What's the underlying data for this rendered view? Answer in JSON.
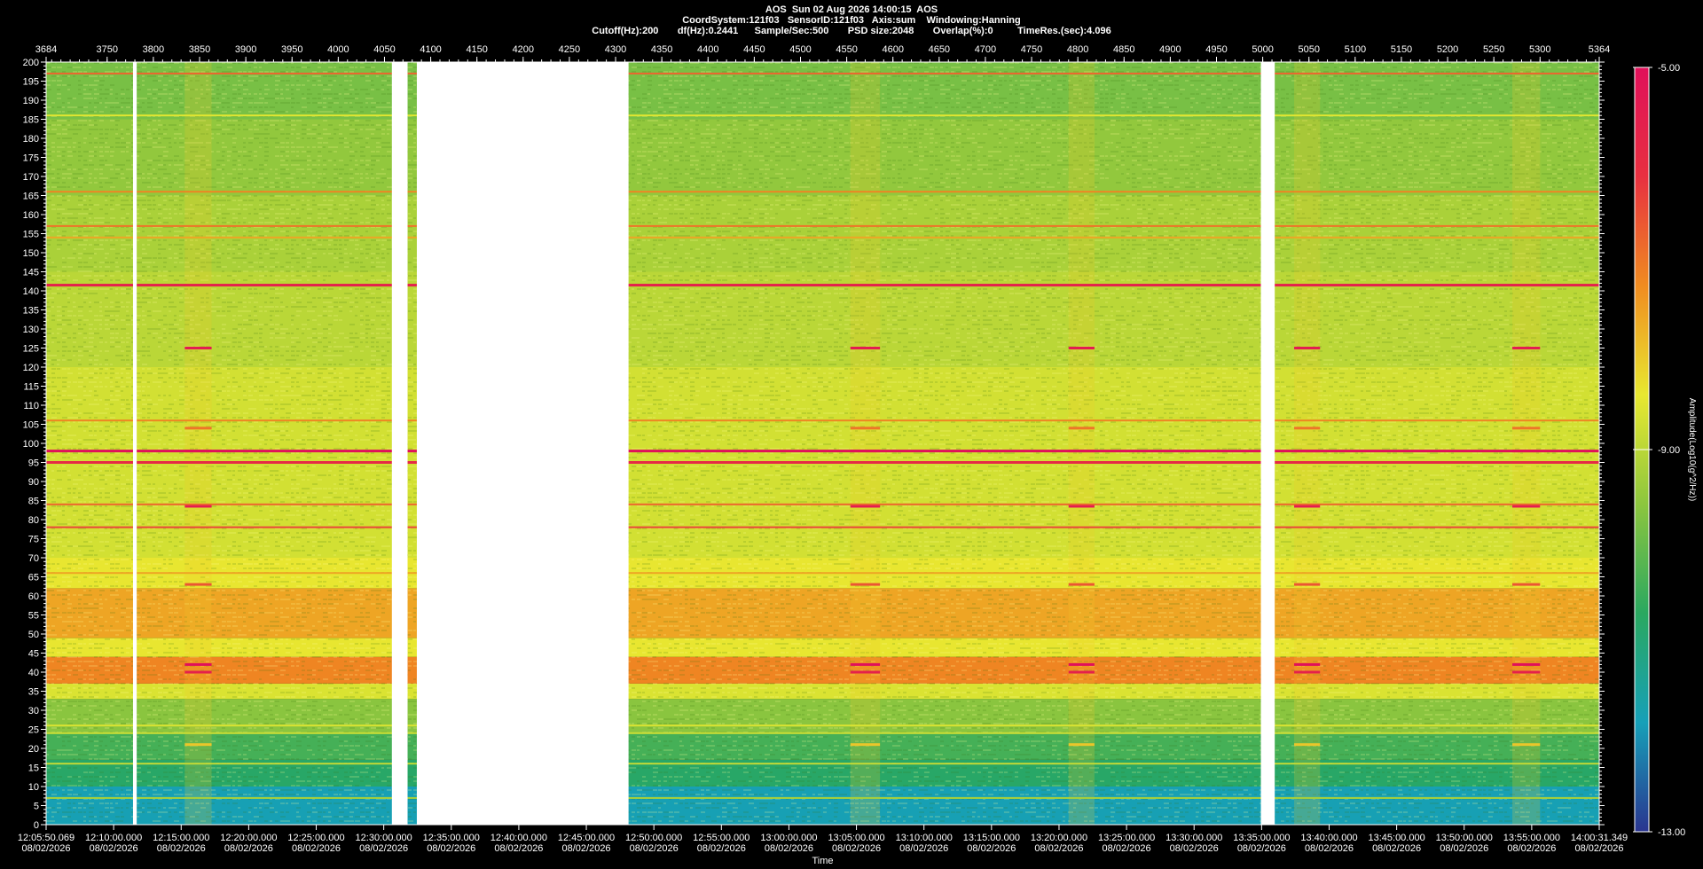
{
  "header": {
    "line1": "AOS  Sun 02 Aug 2026 14:00:15  AOS",
    "line2": "CoordSystem:121f03   SensorID:121f03   Axis:sum    Windowing:Hanning",
    "line3": "Cutoff(Hz):200       df(Hz):0.2441      Sample/Sec:500       PSD size:2048       Overlap(%):0         TimeRes.(sec):4.096"
  },
  "chart_data": {
    "type": "heatmap",
    "title": "AOS  Sun 02 Aug 2026 14:00:15  AOS",
    "xlabel": "Time",
    "ylabel": "",
    "colorbar_label": "Amplitude(Log10(g^2/Hz))",
    "colorbar_ticks": [
      "-5.00",
      "-9.00",
      "-13.00"
    ],
    "colorbar_range": [
      -13,
      -5
    ],
    "colormap": [
      "#2a3590",
      "#16a0b8",
      "#2aa860",
      "#8cc63e",
      "#e8e830",
      "#f08c20",
      "#e83040",
      "#e0105a"
    ],
    "ylim": [
      0,
      200
    ],
    "y_ticks": [
      0,
      5,
      10,
      15,
      20,
      25,
      30,
      35,
      40,
      45,
      50,
      55,
      60,
      65,
      70,
      75,
      80,
      85,
      90,
      95,
      100,
      105,
      110,
      115,
      120,
      125,
      130,
      135,
      140,
      145,
      150,
      155,
      160,
      165,
      170,
      175,
      180,
      185,
      190,
      195,
      200
    ],
    "top_axis_range": [
      3684,
      5364
    ],
    "top_axis_ticks": [
      "3684",
      "3750",
      "3800",
      "3850",
      "3900",
      "3950",
      "4000",
      "4050",
      "4100",
      "4150",
      "4200",
      "4250",
      "4300",
      "4350",
      "4400",
      "4450",
      "4500",
      "4550",
      "4600",
      "4650",
      "4700",
      "4750",
      "4800",
      "4850",
      "4900",
      "4950",
      "5000",
      "5050",
      "5100",
      "5150",
      "5200",
      "5250",
      "5300",
      "5364"
    ],
    "time_ticks": [
      {
        "time": "12:05:50.069",
        "date": "08/02/2026"
      },
      {
        "time": "12:10:00.000",
        "date": "08/02/2026"
      },
      {
        "time": "12:15:00.000",
        "date": "08/02/2026"
      },
      {
        "time": "12:20:00.000",
        "date": "08/02/2026"
      },
      {
        "time": "12:25:00.000",
        "date": "08/02/2026"
      },
      {
        "time": "12:30:00.000",
        "date": "08/02/2026"
      },
      {
        "time": "12:35:00.000",
        "date": "08/02/2026"
      },
      {
        "time": "12:40:00.000",
        "date": "08/02/2026"
      },
      {
        "time": "12:45:00.000",
        "date": "08/02/2026"
      },
      {
        "time": "12:50:00.000",
        "date": "08/02/2026"
      },
      {
        "time": "12:55:00.000",
        "date": "08/02/2026"
      },
      {
        "time": "13:00:00.000",
        "date": "08/02/2026"
      },
      {
        "time": "13:05:00.000",
        "date": "08/02/2026"
      },
      {
        "time": "13:10:00.000",
        "date": "08/02/2026"
      },
      {
        "time": "13:15:00.000",
        "date": "08/02/2026"
      },
      {
        "time": "13:20:00.000",
        "date": "08/02/2026"
      },
      {
        "time": "13:25:00.000",
        "date": "08/02/2026"
      },
      {
        "time": "13:30:00.000",
        "date": "08/02/2026"
      },
      {
        "time": "13:35:00.000",
        "date": "08/02/2026"
      },
      {
        "time": "13:40:00.000",
        "date": "08/02/2026"
      },
      {
        "time": "13:45:00.000",
        "date": "08/02/2026"
      },
      {
        "time": "13:50:00.000",
        "date": "08/02/2026"
      },
      {
        "time": "13:55:00.000",
        "date": "08/02/2026"
      },
      {
        "time": "14:00:31.349",
        "date": "08/02/2026"
      }
    ],
    "data_gaps": [
      [
        3778,
        3782
      ],
      [
        4058,
        4075
      ],
      [
        4085,
        4314
      ],
      [
        4998,
        5013
      ]
    ],
    "bursts": [
      [
        3834,
        3863
      ],
      [
        4554,
        4586
      ],
      [
        4790,
        4818
      ],
      [
        5034,
        5062
      ],
      [
        5270,
        5300
      ]
    ],
    "spectral_levels": [
      {
        "from": 0,
        "to": 10,
        "level": -11.8
      },
      {
        "from": 10,
        "to": 17,
        "level": -10.8
      },
      {
        "from": 17,
        "to": 24,
        "level": -10.4
      },
      {
        "from": 24,
        "to": 33,
        "level": -9.6
      },
      {
        "from": 33,
        "to": 37,
        "level": -8.6
      },
      {
        "from": 37,
        "to": 44,
        "level": -7.2
      },
      {
        "from": 44,
        "to": 49,
        "level": -8.4
      },
      {
        "from": 49,
        "to": 62,
        "level": -7.6
      },
      {
        "from": 62,
        "to": 70,
        "level": -8.4
      },
      {
        "from": 70,
        "to": 120,
        "level": -8.7
      },
      {
        "from": 120,
        "to": 145,
        "level": -9.0
      },
      {
        "from": 145,
        "to": 165,
        "level": -9.2
      },
      {
        "from": 165,
        "to": 185,
        "level": -9.5
      },
      {
        "from": 185,
        "to": 200,
        "level": -9.8
      }
    ],
    "spectral_lines": [
      {
        "freq": 197,
        "level": -6.8
      },
      {
        "freq": 186,
        "level": -8.5
      },
      {
        "freq": 166,
        "level": -7.2
      },
      {
        "freq": 157,
        "level": -7.0
      },
      {
        "freq": 154,
        "level": -7.6
      },
      {
        "freq": 141.5,
        "level": -5.6
      },
      {
        "freq": 106,
        "level": -7.2
      },
      {
        "freq": 98,
        "level": -5.0
      },
      {
        "freq": 95,
        "level": -5.9
      },
      {
        "freq": 84,
        "level": -6.8
      },
      {
        "freq": 78,
        "level": -6.4
      },
      {
        "freq": 66,
        "level": -7.6
      },
      {
        "freq": 26,
        "level": -8.6
      },
      {
        "freq": 24,
        "level": -8.8
      },
      {
        "freq": 16,
        "level": -8.9
      },
      {
        "freq": 7,
        "level": -9.2
      }
    ],
    "grid": false
  }
}
